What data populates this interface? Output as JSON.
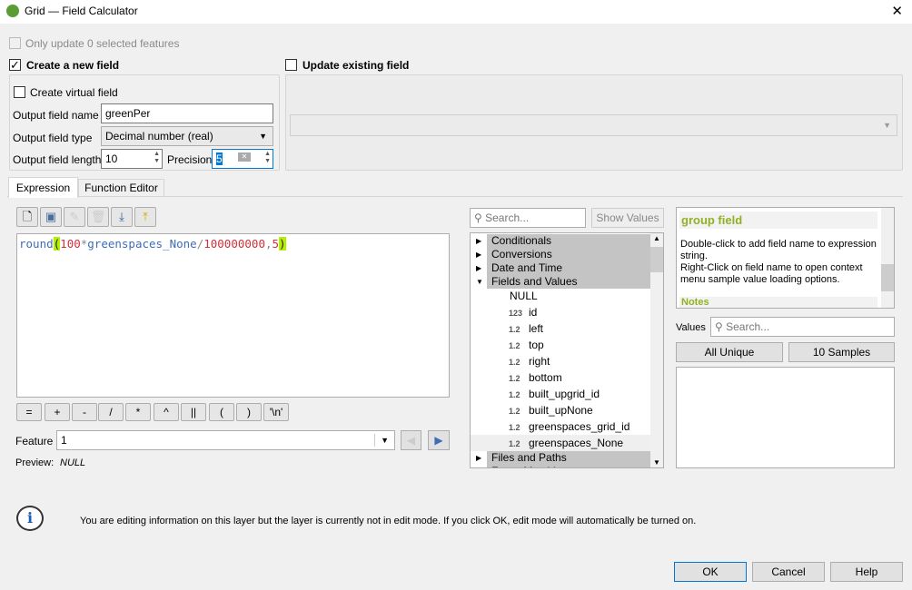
{
  "window": {
    "title": "Grid — Field Calculator",
    "close": "✕"
  },
  "only_update": "Only update 0 selected features",
  "create_new": {
    "label": "Create a new field",
    "checked": true,
    "virtual_label": "Create virtual field",
    "name_label": "Output field name",
    "name_value": "greenPer",
    "type_label": "Output field type",
    "type_value": "Decimal number (real)",
    "length_label": "Output field length",
    "length_value": "10",
    "precision_label": "Precision",
    "precision_value": "5"
  },
  "update_existing": {
    "label": "Update existing field",
    "checked": false
  },
  "tabs": [
    {
      "label": "Expression",
      "active": true
    },
    {
      "label": "Function Editor",
      "active": false
    }
  ],
  "expression": {
    "tokens": [
      {
        "t": "round",
        "c": "#3e6db5"
      },
      {
        "t": "(",
        "c": "#222",
        "hl": true
      },
      {
        "t": "100",
        "c": "#d0303a"
      },
      {
        "t": "*",
        "c": "#888"
      },
      {
        "t": "greenspaces_None",
        "c": "#3e6db5"
      },
      {
        "t": "/",
        "c": "#888"
      },
      {
        "t": "100000000",
        "c": "#d0303a"
      },
      {
        "t": ",",
        "c": "#888"
      },
      {
        "t": "5",
        "c": "#d0303a"
      },
      {
        "t": ")",
        "c": "#222",
        "hl": true
      }
    ],
    "highlight": "#b4f000"
  },
  "operators": [
    "=",
    "+",
    "-",
    "/",
    "*",
    "^",
    "||",
    "(",
    ")",
    "'\\n'"
  ],
  "feature": {
    "label": "Feature",
    "value": "1"
  },
  "preview": {
    "label": "Preview:",
    "value": "NULL"
  },
  "search": {
    "placeholder": "Search...",
    "show_values": "Show Values"
  },
  "tree": {
    "categories_top": [
      "Conditionals",
      "Conversions",
      "Date and Time",
      "Fields and Values"
    ],
    "null_item": "NULL",
    "fields": [
      {
        "type": "123",
        "name": "id"
      },
      {
        "type": "1.2",
        "name": "left"
      },
      {
        "type": "1.2",
        "name": "top"
      },
      {
        "type": "1.2",
        "name": "right"
      },
      {
        "type": "1.2",
        "name": "bottom"
      },
      {
        "type": "1.2",
        "name": "built_upgrid_id"
      },
      {
        "type": "1.2",
        "name": "built_upNone"
      },
      {
        "type": "1.2",
        "name": "greenspaces_grid_id"
      },
      {
        "type": "1.2",
        "name": "greenspaces_None",
        "selected": true
      }
    ],
    "categories_bottom": [
      "Files and Paths",
      "Fuzzy Matching"
    ]
  },
  "help": {
    "title": "group field",
    "body1": "Double-click to add field name to expression string.",
    "body2": "Right-Click on field name to open context menu sample value loading options.",
    "notes": "Notes",
    "accent": "#93b023"
  },
  "values": {
    "label": "Values",
    "placeholder": "Search...",
    "all_unique": "All Unique",
    "samples": "10 Samples"
  },
  "info": {
    "message": "You are editing information on this layer but the layer is currently not in edit mode. If you click OK, edit mode will automatically be turned on."
  },
  "buttons": {
    "ok": "OK",
    "cancel": "Cancel",
    "help": "Help"
  }
}
